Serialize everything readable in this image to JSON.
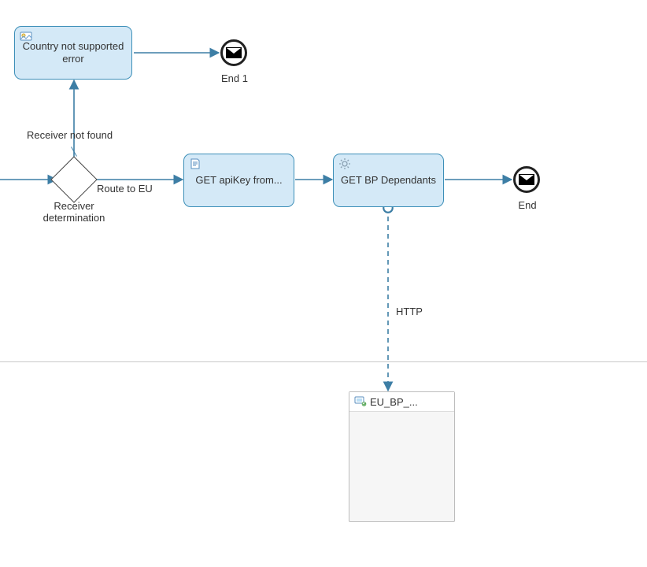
{
  "nodes": {
    "error_activity": {
      "label": "Country not\nsupported error"
    },
    "get_apikey": {
      "label": "GET apiKey\nfrom..."
    },
    "get_bp_dep": {
      "label": "GET BP\nDependants"
    },
    "end1": {
      "label": "End 1"
    },
    "end": {
      "label": "End"
    },
    "gateway": {
      "label": "Receiver\ndetermination"
    }
  },
  "edges": {
    "not_found": {
      "label": "Receiver not found"
    },
    "route_eu": {
      "label": "Route to EU"
    },
    "http_msg": {
      "label": "HTTP"
    }
  },
  "participant": {
    "eu_bp": {
      "label": "EU_BP_..."
    }
  },
  "icons": {
    "mapping": "mapping-icon",
    "script": "script-icon",
    "gear": "gear-icon",
    "system": "system-icon"
  }
}
